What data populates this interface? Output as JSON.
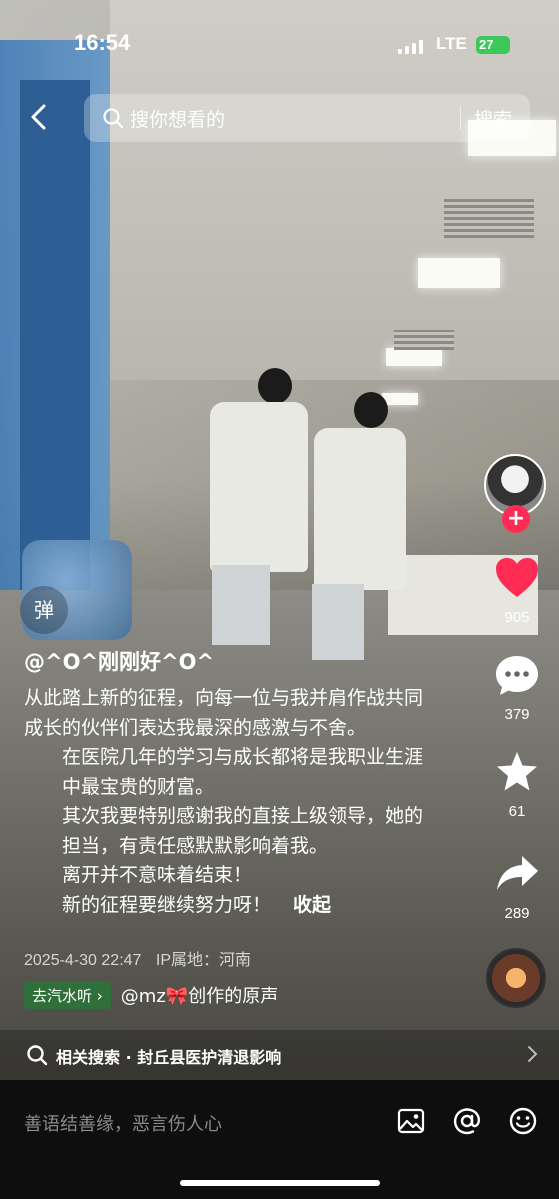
{
  "status_bar": {
    "time": "16:54",
    "network": "LTE",
    "battery": "27"
  },
  "search": {
    "placeholder": "搜你想看的",
    "button": "搜索"
  },
  "danmaku_label": "弹",
  "author": "@^O^刚刚好^O^",
  "caption_lines": [
    "从此踏上新的征程，向每一位与我并肩作战共同成长的伙伴们表达我最深的感激与不舍。",
    "在医院几年的学习与成长都将是我职业生涯中最宝贵的财富。",
    "其次我要特别感谢我的直接上级领导，她的担当，有责任感默默影响着我。",
    "离开并不意味着结束！",
    "新的征程要继续努力呀！"
  ],
  "collapse_label": "收起",
  "post_time": "2025-4-30 22:47",
  "ip_location": "IP属地：河南",
  "music": {
    "button": "去汽水听",
    "text": "@mz🎀创作的原声"
  },
  "actions": {
    "likes": "905",
    "comments": "379",
    "favorites": "61",
    "shares": "289"
  },
  "related_search": {
    "prefix": "相关搜索 ·",
    "query": "封丘县医护清退影响"
  },
  "comment_placeholder": "善语结善缘，恶言伤人心",
  "colors": {
    "like": "#fe2c55",
    "follow": "#fe2c55",
    "music_button": "#2f6f3a",
    "battery": "#3cc85a"
  },
  "icons": [
    "back-icon",
    "search-icon",
    "heart-icon",
    "comment-icon",
    "star-icon",
    "share-icon",
    "image-icon",
    "at-icon",
    "emoji-icon",
    "chevron-right-icon"
  ]
}
